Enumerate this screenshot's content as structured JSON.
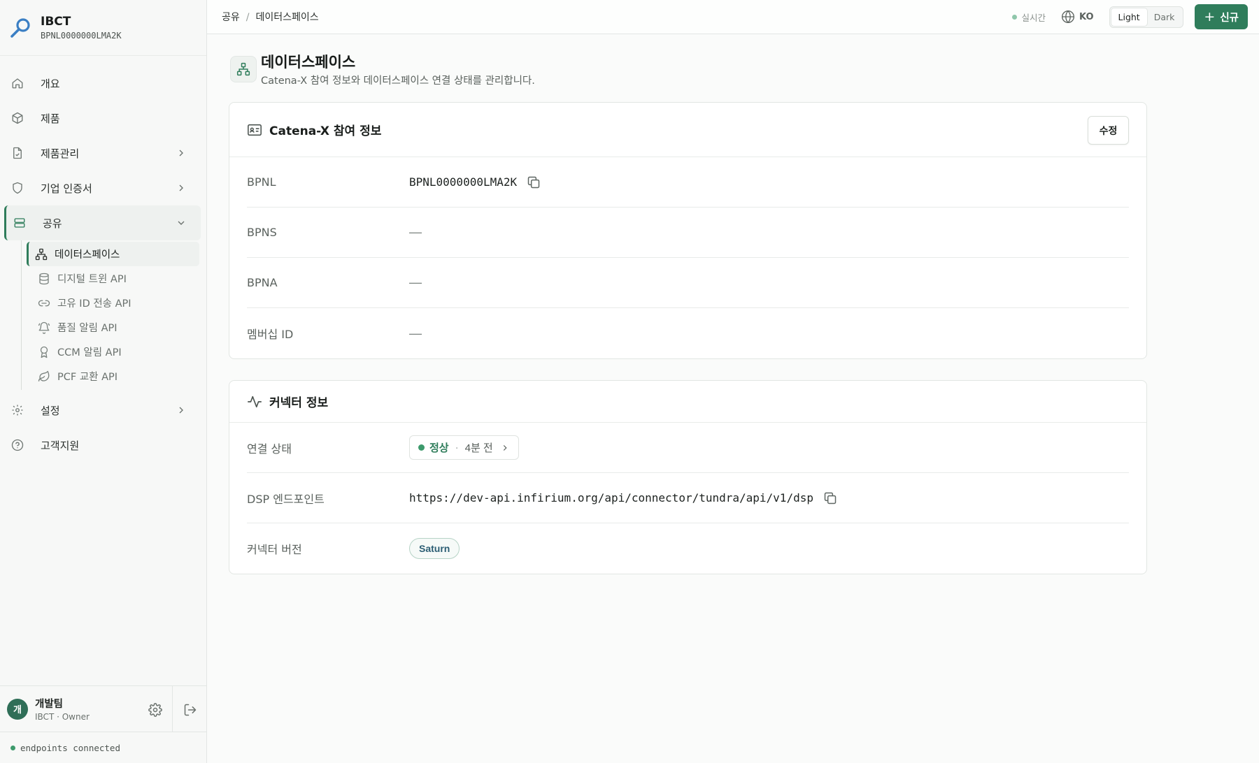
{
  "brand": {
    "name": "IBCT",
    "bpnl": "BPNL0000000LMA2K"
  },
  "nav": {
    "overview": "개요",
    "products": "제품",
    "product_mgmt": "제품관리",
    "certificates": "기업 인증서",
    "sharing": "공유",
    "sub_items": [
      {
        "label": "데이터스페이스"
      },
      {
        "label": "디지털 트윈 API"
      },
      {
        "label": "고유 ID 전송 API"
      },
      {
        "label": "품질 알림 API"
      },
      {
        "label": "CCM 알림 API"
      },
      {
        "label": "PCF 교환 API"
      }
    ],
    "settings": "설정",
    "support": "고객지원"
  },
  "user": {
    "initial": "개",
    "name": "개발팀",
    "role": "IBCT · Owner"
  },
  "footer_status": "endpoints connected",
  "topbar": {
    "breadcrumb": [
      "공유",
      "데이터스페이스"
    ],
    "breadcrumb_sep": "/",
    "live": "실시간",
    "lang": "KO",
    "theme_light": "Light",
    "theme_dark": "Dark",
    "new_button": "신규"
  },
  "page": {
    "title": "데이터스페이스",
    "subtitle": "Catena-X 참여 정보와 데이터스페이스 연결 상태를 관리합니다."
  },
  "participation": {
    "title": "Catena-X 참여 정보",
    "edit": "수정",
    "rows": [
      {
        "label": "BPNL",
        "value": "BPNL0000000LMA2K"
      },
      {
        "label": "BPNS",
        "value": "—"
      },
      {
        "label": "BPNA",
        "value": "—"
      },
      {
        "label": "멤버십 ID",
        "value": "—"
      }
    ]
  },
  "connector": {
    "title": "커넥터 정보",
    "status_label": "연결 상태",
    "status_ok": "정상",
    "status_sep": "·",
    "status_ago": "4분 전",
    "dsp_label": "DSP 엔드포인트",
    "dsp_value": "https://dev-api.infirium.org/api/connector/tundra/api/v1/dsp",
    "version_label": "커넥터 버전",
    "version_value": "Saturn"
  },
  "colors": {
    "accent": "#2f7d5b",
    "status_ok": "#3d9a6c"
  }
}
